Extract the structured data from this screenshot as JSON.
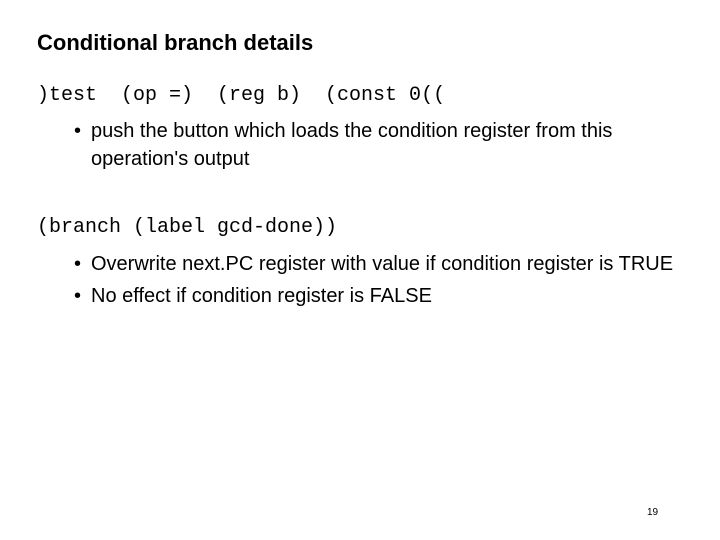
{
  "slide": {
    "title": "Conditional branch details",
    "code_lines": [
      ")test  (op =)  (reg b)  (const 0((",
      "(branch (label gcd-done))"
    ],
    "sections": [
      {
        "bullets": [
          "push the button which loads the condition register from this operation's output"
        ]
      },
      {
        "bullets": [
          "Overwrite next.PC register with value if condition register is TRUE",
          "No effect if condition register is FALSE"
        ]
      }
    ],
    "bullet_glyph": "•",
    "page_number": "19"
  }
}
